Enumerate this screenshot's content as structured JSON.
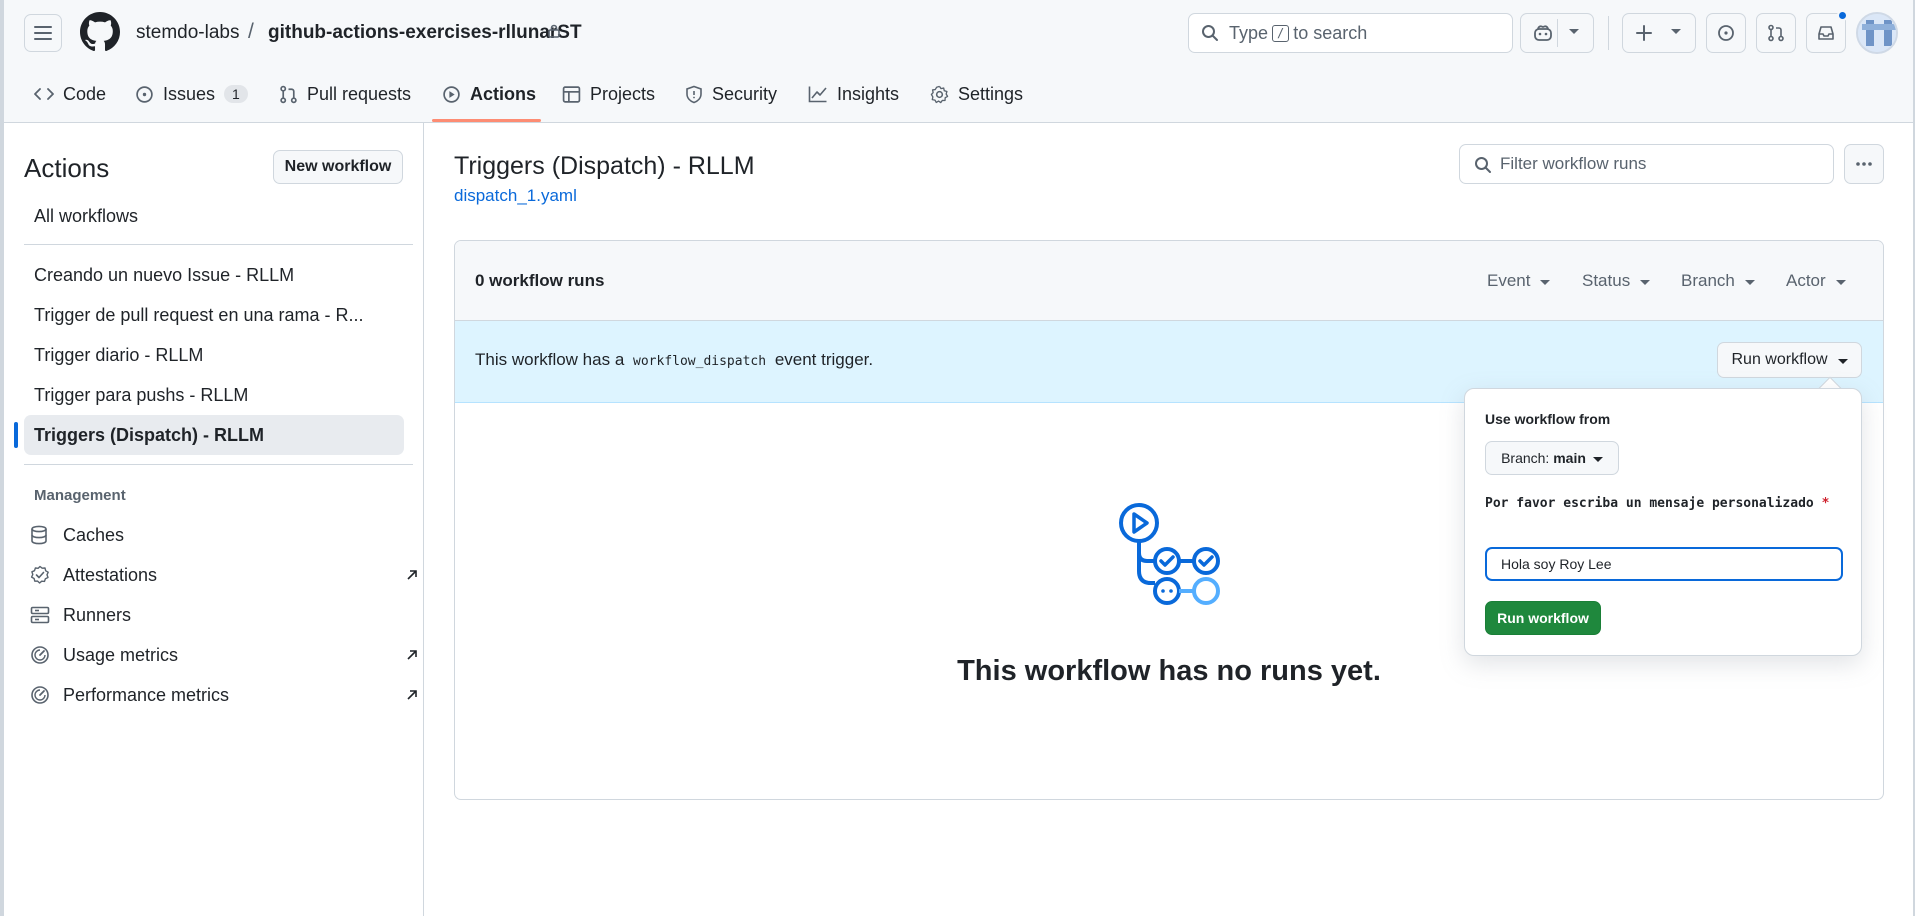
{
  "header": {
    "owner": "stemdo-labs",
    "separator": "/",
    "repo": "github-actions-exercises-rllunarST",
    "search_prefix": "Type",
    "search_key": "/",
    "search_suffix": "to search"
  },
  "tabs": [
    {
      "label": "Code",
      "icon": "code-icon"
    },
    {
      "label": "Issues",
      "icon": "issue-icon",
      "count": "1"
    },
    {
      "label": "Pull requests",
      "icon": "pull-request-icon"
    },
    {
      "label": "Actions",
      "icon": "play-icon",
      "active": true
    },
    {
      "label": "Projects",
      "icon": "table-icon"
    },
    {
      "label": "Security",
      "icon": "shield-icon"
    },
    {
      "label": "Insights",
      "icon": "graph-icon"
    },
    {
      "label": "Settings",
      "icon": "gear-icon"
    }
  ],
  "sidebar": {
    "title": "Actions",
    "new_workflow": "New workflow",
    "all_workflows": "All workflows",
    "workflows": [
      "Creando un nuevo Issue - RLLM",
      "Trigger de pull request en una rama - R...",
      "Trigger diario - RLLM",
      "Trigger para pushs - RLLM",
      "Triggers (Dispatch) - RLLM"
    ],
    "management_label": "Management",
    "management": [
      {
        "label": "Caches",
        "icon": "database-icon",
        "external": false
      },
      {
        "label": "Attestations",
        "icon": "verified-icon",
        "external": true
      },
      {
        "label": "Runners",
        "icon": "server-icon",
        "external": false
      },
      {
        "label": "Usage metrics",
        "icon": "meter-icon",
        "external": true
      },
      {
        "label": "Performance metrics",
        "icon": "meter-icon",
        "external": true
      }
    ]
  },
  "main": {
    "title": "Triggers (Dispatch) - RLLM",
    "file_link": "dispatch_1.yaml",
    "filter_placeholder": "Filter workflow runs",
    "runs_count": "0 workflow runs",
    "filters": [
      "Event",
      "Status",
      "Branch",
      "Actor"
    ],
    "banner_prefix": "This workflow has a",
    "banner_code": "workflow_dispatch",
    "banner_suffix": "event trigger.",
    "run_workflow_dropdown": "Run workflow",
    "empty_text": "This workflow has no runs yet."
  },
  "popover": {
    "use_from": "Use workflow from",
    "branch_prefix": "Branch:",
    "branch_value": "main",
    "input_label": "Por favor escriba un mensaje personalizado",
    "required_mark": "*",
    "input_value": "Hola soy Roy Lee",
    "run_button": "Run workflow"
  },
  "colors": {
    "accent_blue": "#0969da",
    "tab_underline": "#fd8c73",
    "run_green": "#1f883d",
    "banner_bg": "#ddf4ff"
  }
}
